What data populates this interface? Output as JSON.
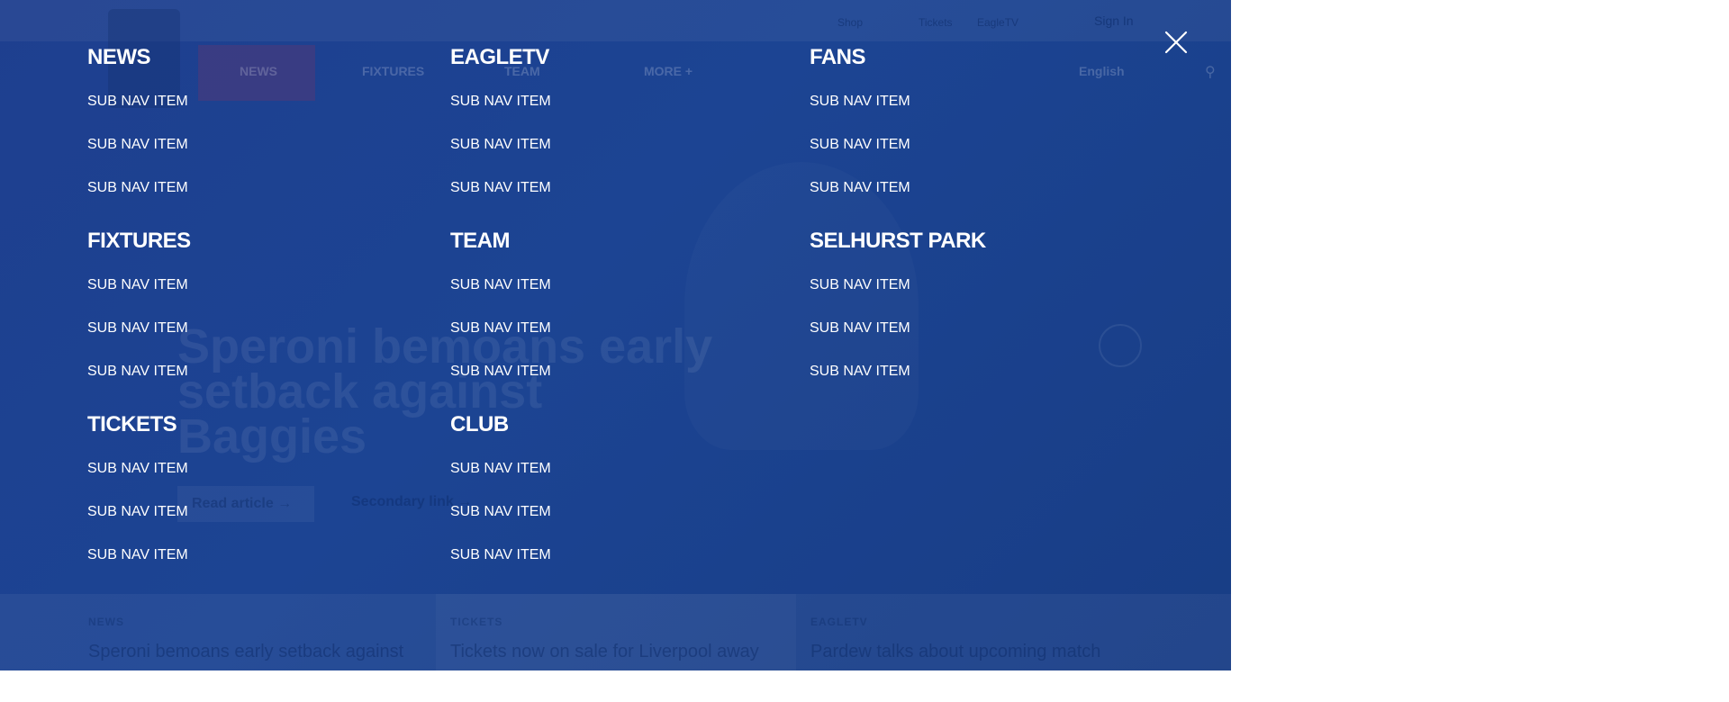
{
  "underlying_page": {
    "sign_in": "Sign In",
    "top_links": [
      "Shop",
      "Tickets",
      "EagleTV"
    ],
    "nav": [
      "NEWS",
      "FIXTURES",
      "TEAM",
      "MORE +"
    ],
    "language": "English",
    "headline": "Speroni bemoans early setback against Baggies",
    "read_button": "Read article →",
    "secondary_link": "Secondary link →",
    "cards": [
      {
        "category": "NEWS",
        "title": "Speroni bemoans early setback against"
      },
      {
        "category": "TICKETS",
        "title": "Tickets now on sale for Liverpool away"
      },
      {
        "category": "EAGLETV",
        "title": "Pardew talks about upcoming match"
      }
    ]
  },
  "menu": {
    "sections": [
      {
        "title": "NEWS",
        "items": [
          "SUB NAV ITEM",
          "SUB NAV ITEM",
          "SUB NAV ITEM"
        ]
      },
      {
        "title": "EAGLETV",
        "items": [
          "SUB NAV ITEM",
          "SUB NAV ITEM",
          "SUB NAV ITEM"
        ]
      },
      {
        "title": "FANS",
        "items": [
          "SUB NAV ITEM",
          "SUB NAV ITEM",
          "SUB NAV ITEM"
        ]
      },
      {
        "title": "FIXTURES",
        "items": [
          "SUB NAV ITEM",
          "SUB NAV ITEM",
          "SUB NAV ITEM"
        ]
      },
      {
        "title": "TEAM",
        "items": [
          "SUB NAV ITEM",
          "SUB NAV ITEM",
          "SUB NAV ITEM"
        ]
      },
      {
        "title": "SELHURST PARK",
        "items": [
          "SUB NAV ITEM",
          "SUB NAV ITEM",
          "SUB NAV ITEM"
        ]
      },
      {
        "title": "TICKETS",
        "items": [
          "SUB NAV ITEM",
          "SUB NAV ITEM",
          "SUB NAV ITEM"
        ]
      },
      {
        "title": "CLUB",
        "items": [
          "SUB NAV ITEM",
          "SUB NAV ITEM",
          "SUB NAV ITEM"
        ]
      }
    ],
    "close_icon": "close-icon"
  },
  "colors": {
    "overlay_blue": "#1c4493",
    "text": "#ffffff",
    "page_background": "#ffffff"
  }
}
